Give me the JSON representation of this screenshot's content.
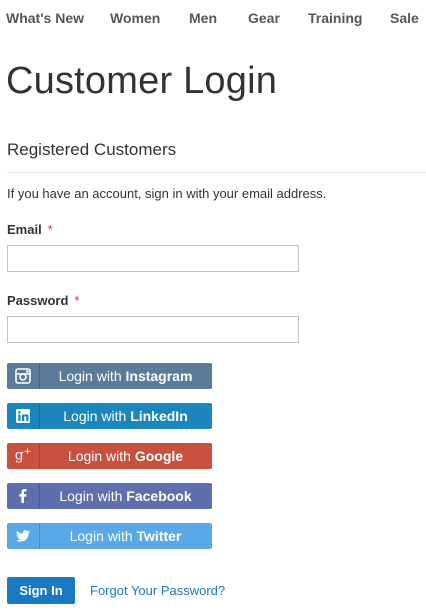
{
  "nav": {
    "items": [
      {
        "label": "What's New"
      },
      {
        "label": "Women"
      },
      {
        "label": "Men"
      },
      {
        "label": "Gear"
      },
      {
        "label": "Training"
      },
      {
        "label": "Sale"
      }
    ]
  },
  "page_title": "Customer Login",
  "section_title": "Registered Customers",
  "intro": "If you have an account, sign in with your email address.",
  "form": {
    "email_label": "Email",
    "email_value": "",
    "password_label": "Password",
    "password_value": "",
    "required_mark": "*"
  },
  "social": [
    {
      "prefix": "Login with ",
      "provider": "Instagram",
      "color": "#5b7b9a",
      "icon": "instagram-icon"
    },
    {
      "prefix": "Login with ",
      "provider": "LinkedIn",
      "color": "#1a86bb",
      "icon": "linkedin-icon"
    },
    {
      "prefix": "Login with ",
      "provider": "Google",
      "color": "#c8503f",
      "icon": "google-plus-icon"
    },
    {
      "prefix": "Login with ",
      "provider": "Facebook",
      "color": "#5d6fad",
      "icon": "facebook-icon"
    },
    {
      "prefix": "Login with ",
      "provider": "Twitter",
      "color": "#5aa9e6",
      "icon": "twitter-icon"
    }
  ],
  "actions": {
    "signin_label": "Sign In",
    "forgot_label": "Forgot Your Password?",
    "primary_color": "#1979c3"
  }
}
